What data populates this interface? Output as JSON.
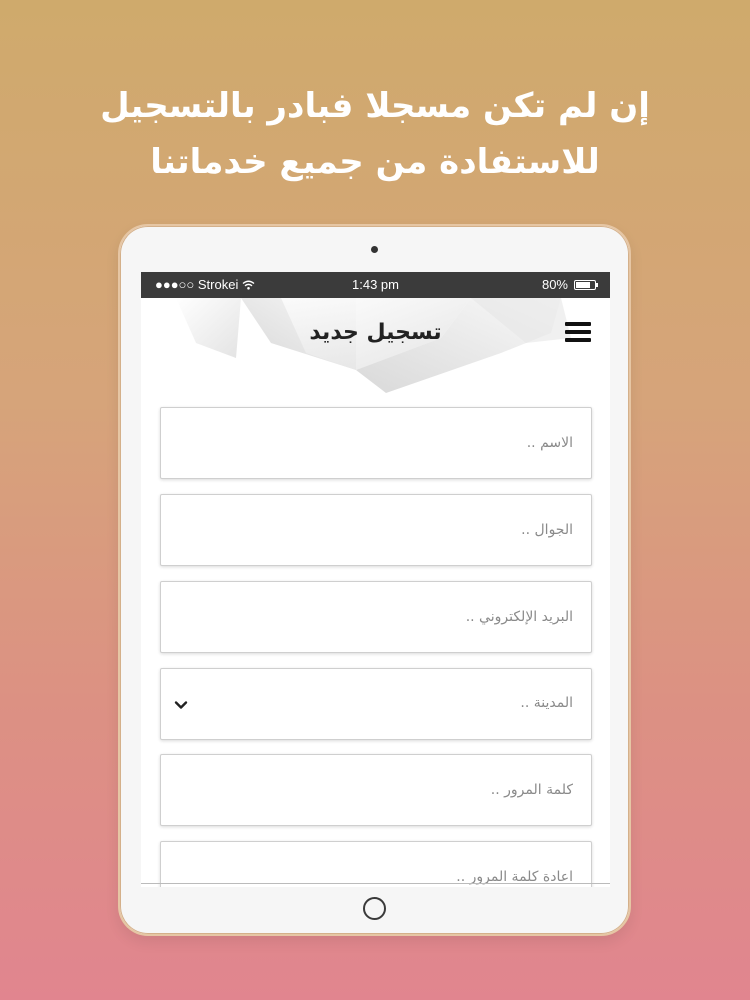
{
  "headline": {
    "line1": "إن لم تكن مسجلا فبادر بالتسجيل",
    "line2": "للاستفادة من جميع خدماتنا"
  },
  "status_bar": {
    "carrier": "●●●○○ Strokei",
    "time": "1:43 pm",
    "battery": "80%",
    "battery_level": 0.8
  },
  "header": {
    "title": "تسجيل جديد",
    "menu_icon": "hamburger-menu-icon"
  },
  "form": {
    "name_placeholder": "الاسم ..",
    "mobile_placeholder": "الجوال ..",
    "email_placeholder": "البريد الإلكتروني ..",
    "city_placeholder": "المدينة ..",
    "password_placeholder": "كلمة المرور ..",
    "confirm_password_placeholder": "اعادة كلمة المرور .."
  },
  "colors": {
    "background_top": "#cfaa6c",
    "background_bottom": "#e1858f",
    "status_bar": "#3b3b3b"
  }
}
